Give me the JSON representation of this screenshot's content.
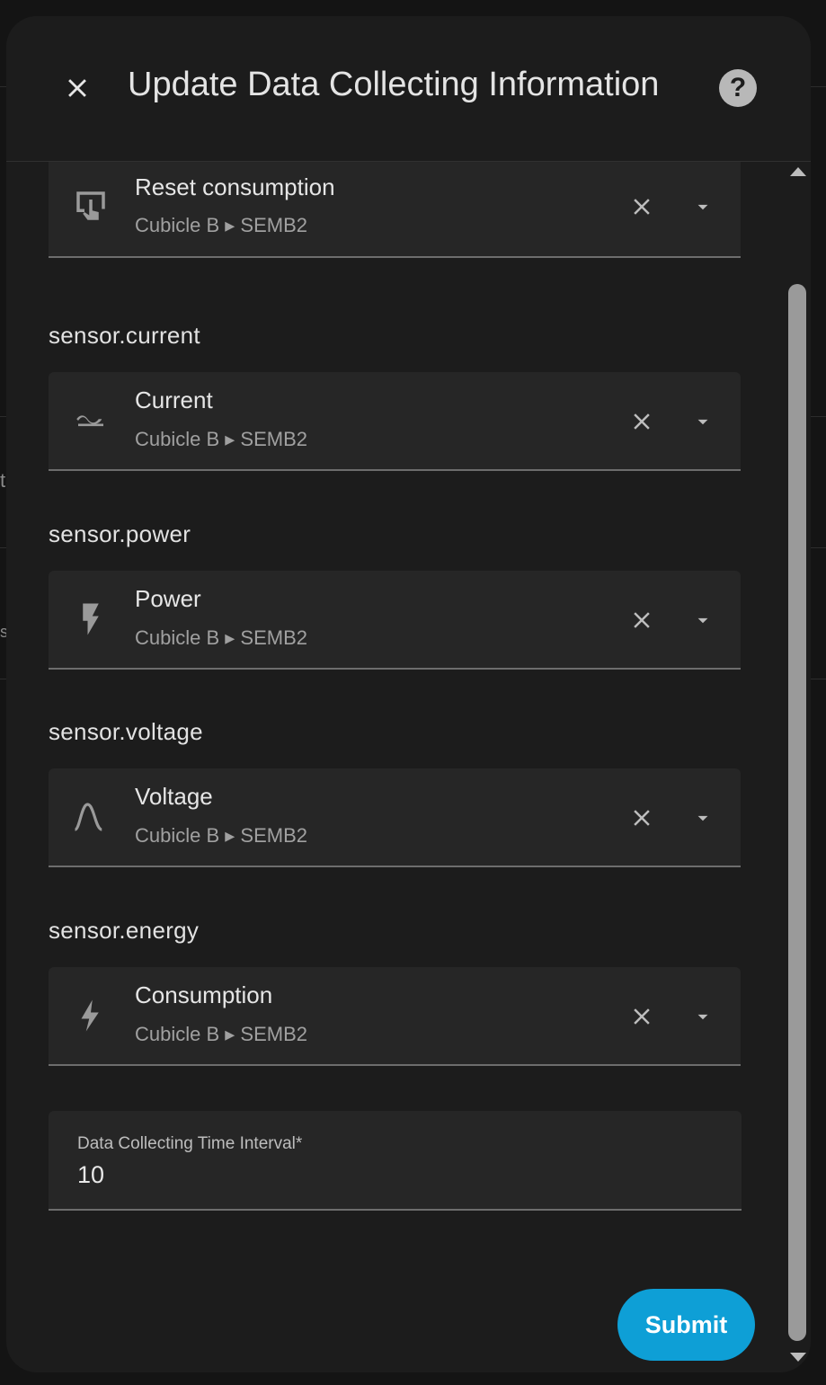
{
  "background": {
    "fragments": [
      "t",
      "s"
    ]
  },
  "dialog": {
    "title": "Update Data Collecting Information",
    "close_icon": "close-icon",
    "help_icon": "help-circle-icon",
    "help_glyph": "?"
  },
  "pickers": [
    {
      "label": "",
      "name": "Reset consumption",
      "location": "Cubicle B ▸ SEMB2",
      "icon": "button-press-icon"
    },
    {
      "label": "sensor.current",
      "name": "Current",
      "location": "Cubicle B ▸ SEMB2",
      "icon": "current-ac-icon"
    },
    {
      "label": "sensor.power",
      "name": "Power",
      "location": "Cubicle B ▸ SEMB2",
      "icon": "flash-icon"
    },
    {
      "label": "sensor.voltage",
      "name": "Voltage",
      "location": "Cubicle B ▸ SEMB2",
      "icon": "sine-wave-icon"
    },
    {
      "label": "sensor.energy",
      "name": "Consumption",
      "location": "Cubicle B ▸ SEMB2",
      "icon": "lightning-bolt-icon"
    }
  ],
  "interval": {
    "label": "Data Collecting Time Interval*",
    "value": "10"
  },
  "submit_label": "Submit",
  "colors": {
    "accent": "#0e9fd6",
    "surface": "#1c1c1c",
    "field": "#262626"
  }
}
